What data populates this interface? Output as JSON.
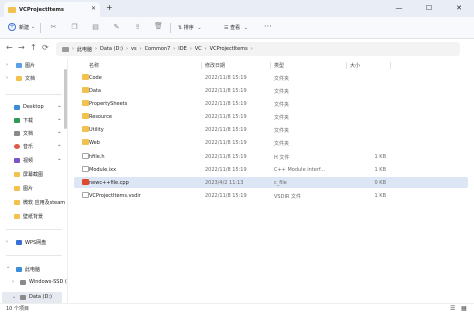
{
  "window": {
    "tab_title": "VCProjectItems",
    "tab_close": "✕",
    "new_tab": "+",
    "minimize": "—",
    "maximize": "☐",
    "close": "✕"
  },
  "toolbar": {
    "new_label": "新建",
    "sort_label": "排序",
    "view_label": "查看",
    "more": "···",
    "caret": "⌄"
  },
  "address": {
    "back": "←",
    "forward": "→",
    "up": "↑",
    "refresh": "⟳",
    "crumbs": [
      "此电脑",
      "Data (D:)",
      "vs",
      "Common7",
      "IDE",
      "VC",
      "VCProjectItems"
    ],
    "sep": "›"
  },
  "sidebar": {
    "items": [
      {
        "label": "图片",
        "color": "#5aa0e8"
      },
      {
        "label": "文档",
        "color": "#f2c14e"
      },
      {
        "label": "Desktop",
        "color": "#3b8fd8"
      },
      {
        "label": "下载",
        "color": "#2f9a57"
      },
      {
        "label": "文档",
        "color": "#8a8a8a"
      },
      {
        "label": "音乐",
        "color": "#e05a4a"
      },
      {
        "label": "视频",
        "color": "#7b55c7"
      },
      {
        "label": "屏幕截图",
        "color": "#f2c14e"
      },
      {
        "label": "图片",
        "color": "#f2c14e"
      },
      {
        "label": "微软 应用及steam",
        "color": "#f2c14e"
      },
      {
        "label": "壁纸背景",
        "color": "#f2c14e"
      },
      {
        "label": "WPS网盘",
        "color": "#3b6fd8"
      },
      {
        "label": "此电脑",
        "color": "#3b8fd8"
      },
      {
        "label": "Windows-SSD (",
        "color": "#8a8a8a"
      },
      {
        "label": "Data (D:)",
        "color": "#8a8a8a"
      }
    ],
    "chevron_right": "›",
    "chevron_down": "⌄",
    "pin": "⌖"
  },
  "columns": {
    "name": "名称",
    "date": "修改日期",
    "type": "类型",
    "size": "大小"
  },
  "files": [
    {
      "name": "Code",
      "date": "2022/11/8 15:19",
      "type": "文件夹",
      "size": "",
      "kind": "folder"
    },
    {
      "name": "Data",
      "date": "2022/11/8 15:19",
      "type": "文件夹",
      "size": "",
      "kind": "folder"
    },
    {
      "name": "PropertySheets",
      "date": "2022/11/8 15:19",
      "type": "文件夹",
      "size": "",
      "kind": "folder"
    },
    {
      "name": "Resource",
      "date": "2022/11/8 15:19",
      "type": "文件夹",
      "size": "",
      "kind": "folder"
    },
    {
      "name": "Utility",
      "date": "2022/11/8 15:19",
      "type": "文件夹",
      "size": "",
      "kind": "folder"
    },
    {
      "name": "Web",
      "date": "2022/11/8 15:19",
      "type": "文件夹",
      "size": "",
      "kind": "folder"
    },
    {
      "name": "hfile.h",
      "date": "2022/11/8 15:19",
      "type": "H 文件",
      "size": "1 KB",
      "kind": "file"
    },
    {
      "name": "Module.ixx",
      "date": "2022/11/8 15:19",
      "type": "C++ Module interf...",
      "size": "1 KB",
      "kind": "file"
    },
    {
      "name": "newc++file.cpp",
      "date": "2023/4/2 11:13",
      "type": "c_file",
      "size": "0 KB",
      "kind": "cpp"
    },
    {
      "name": "VCProjectItems.vsdir",
      "date": "2022/11/8 15:19",
      "type": "VSDIR 文件",
      "size": "1 KB",
      "kind": "file"
    }
  ],
  "status": {
    "count": "10 个项目",
    "details_view": "☰",
    "tiles_view": "▦"
  }
}
